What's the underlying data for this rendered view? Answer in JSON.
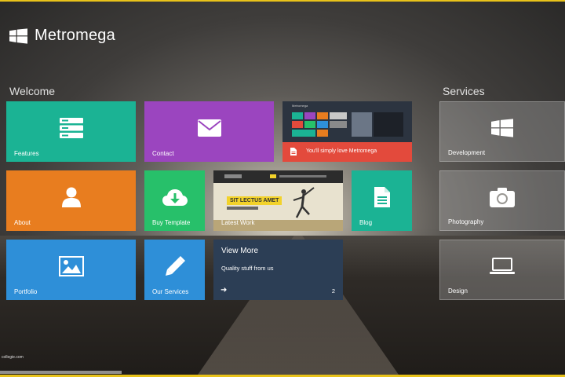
{
  "brand": {
    "name": "Metromega",
    "logo_icon": "windows-logo-icon"
  },
  "sections": {
    "welcome": "Welcome",
    "services": "Services"
  },
  "tiles": {
    "features": {
      "label": "Features",
      "icon": "server-icon",
      "color": "#1bb394"
    },
    "contact": {
      "label": "Contact",
      "icon": "envelope-icon",
      "color": "#9b45bf"
    },
    "screenshot": {
      "banner": "You'll simply love Metromega",
      "icon": "document-icon",
      "color": "#e34a3c",
      "window_title": "Metromega"
    },
    "about": {
      "label": "About",
      "icon": "user-icon",
      "color": "#e87d1f"
    },
    "buy_template": {
      "label": "Buy Template",
      "icon": "cloud-download-icon",
      "color": "#27c06a"
    },
    "latest_work": {
      "label": "Latest Work",
      "headline": "SIT LECTUS AMET"
    },
    "blog": {
      "label": "Blog",
      "icon": "document-icon",
      "color": "#1bb394"
    },
    "portfolio": {
      "label": "Portfolio",
      "icon": "image-icon",
      "color": "#2e8fd8"
    },
    "our_services": {
      "label": "Our Services",
      "icon": "pencil-icon",
      "color": "#2e8fd8"
    },
    "view_more": {
      "title": "View More",
      "text": "Quality stuff from us",
      "arrow_icon": "arrow-right-icon",
      "count": "2"
    },
    "development": {
      "label": "Development",
      "icon": "windows-logo-icon"
    },
    "photography": {
      "label": "Photography",
      "icon": "camera-icon"
    },
    "design": {
      "label": "Design",
      "icon": "laptop-icon"
    }
  },
  "footer": {
    "watermark": "collegie.com"
  }
}
